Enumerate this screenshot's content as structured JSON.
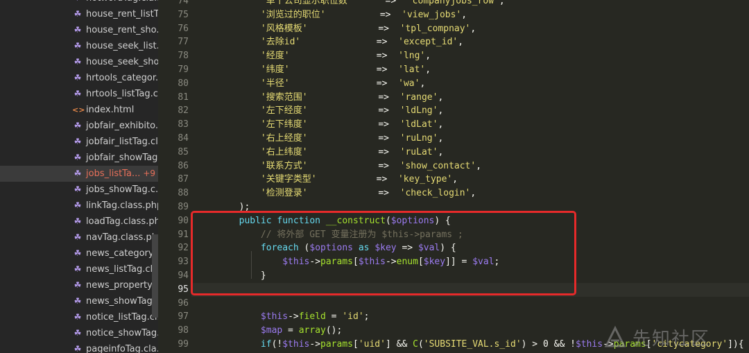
{
  "sidebar": {
    "files": [
      {
        "name": "hotwordTag.cla...",
        "type": "php"
      },
      {
        "name": "house_rent_listT...",
        "type": "php"
      },
      {
        "name": "house_rent_sho...",
        "type": "php"
      },
      {
        "name": "house_seek_list...",
        "type": "php"
      },
      {
        "name": "house_seek_sho...",
        "type": "php"
      },
      {
        "name": "hrtools_categor...",
        "type": "php"
      },
      {
        "name": "hrtools_listTag.c...",
        "type": "php"
      },
      {
        "name": "index.html",
        "type": "html"
      },
      {
        "name": "jobfair_exhibito...",
        "type": "php"
      },
      {
        "name": "jobfair_listTag.cl...",
        "type": "php"
      },
      {
        "name": "jobfair_showTag...",
        "type": "php"
      },
      {
        "name": "jobs_listTa...",
        "type": "php",
        "active": true,
        "badge": "+9"
      },
      {
        "name": "jobs_showTag.c...",
        "type": "php"
      },
      {
        "name": "linkTag.class.php",
        "type": "php"
      },
      {
        "name": "loadTag.class.ph...",
        "type": "php"
      },
      {
        "name": "navTag.class.php",
        "type": "php"
      },
      {
        "name": "news_categoryT...",
        "type": "php"
      },
      {
        "name": "news_listTag.cla...",
        "type": "php"
      },
      {
        "name": "news_propertyT...",
        "type": "php"
      },
      {
        "name": "news_showTag....",
        "type": "php"
      },
      {
        "name": "notice_listTag.cl...",
        "type": "php"
      },
      {
        "name": "notice_showTag...",
        "type": "php"
      },
      {
        "name": "pageinfoTag.cla...",
        "type": "php"
      }
    ]
  },
  "editor": {
    "current_line": "95",
    "lines": [
      {
        "n": "74",
        "tokens": [
          [
            "str",
            "            '单个公司显示职位数'"
          ],
          [
            "op",
            "      =>  "
          ],
          [
            "str",
            "'companyjobs_row'"
          ],
          [
            "op",
            ","
          ]
        ]
      },
      {
        "n": "75",
        "tokens": [
          [
            "str",
            "            '浏览过的职位'"
          ],
          [
            "op",
            "          =>  "
          ],
          [
            "str",
            "'view_jobs'"
          ],
          [
            "op",
            ","
          ]
        ]
      },
      {
        "n": "76",
        "tokens": [
          [
            "str",
            "            '风格模板'"
          ],
          [
            "op",
            "             =>  "
          ],
          [
            "str",
            "'tpl_compnay'"
          ],
          [
            "op",
            ","
          ]
        ]
      },
      {
        "n": "77",
        "tokens": [
          [
            "str",
            "            '去除id'"
          ],
          [
            "op",
            "              =>  "
          ],
          [
            "str",
            "'except_id'"
          ],
          [
            "op",
            ","
          ]
        ]
      },
      {
        "n": "78",
        "tokens": [
          [
            "str",
            "            '经度'"
          ],
          [
            "op",
            "                =>  "
          ],
          [
            "str",
            "'lng'"
          ],
          [
            "op",
            ","
          ]
        ]
      },
      {
        "n": "79",
        "tokens": [
          [
            "str",
            "            '纬度'"
          ],
          [
            "op",
            "                =>  "
          ],
          [
            "str",
            "'lat'"
          ],
          [
            "op",
            ","
          ]
        ]
      },
      {
        "n": "80",
        "tokens": [
          [
            "str",
            "            '半径'"
          ],
          [
            "op",
            "                =>  "
          ],
          [
            "str",
            "'wa'"
          ],
          [
            "op",
            ","
          ]
        ]
      },
      {
        "n": "81",
        "tokens": [
          [
            "str",
            "            '搜索范围'"
          ],
          [
            "op",
            "             =>  "
          ],
          [
            "str",
            "'range'"
          ],
          [
            "op",
            ","
          ]
        ]
      },
      {
        "n": "82",
        "tokens": [
          [
            "str",
            "            '左下经度'"
          ],
          [
            "op",
            "             =>  "
          ],
          [
            "str",
            "'ldLng'"
          ],
          [
            "op",
            ","
          ]
        ]
      },
      {
        "n": "83",
        "tokens": [
          [
            "str",
            "            '左下纬度'"
          ],
          [
            "op",
            "             =>  "
          ],
          [
            "str",
            "'ldLat'"
          ],
          [
            "op",
            ","
          ]
        ]
      },
      {
        "n": "84",
        "tokens": [
          [
            "str",
            "            '右上经度'"
          ],
          [
            "op",
            "             =>  "
          ],
          [
            "str",
            "'ruLng'"
          ],
          [
            "op",
            ","
          ]
        ]
      },
      {
        "n": "85",
        "tokens": [
          [
            "str",
            "            '右上纬度'"
          ],
          [
            "op",
            "             =>  "
          ],
          [
            "str",
            "'ruLat'"
          ],
          [
            "op",
            ","
          ]
        ]
      },
      {
        "n": "86",
        "tokens": [
          [
            "str",
            "            '联系方式'"
          ],
          [
            "op",
            "             =>  "
          ],
          [
            "str",
            "'show_contact'"
          ],
          [
            "op",
            ","
          ]
        ]
      },
      {
        "n": "87",
        "tokens": [
          [
            "str",
            "            '关键字类型'"
          ],
          [
            "op",
            "           =>  "
          ],
          [
            "str",
            "'key_type'"
          ],
          [
            "op",
            ","
          ]
        ]
      },
      {
        "n": "88",
        "tokens": [
          [
            "str",
            "            '检测登录'"
          ],
          [
            "op",
            "             =>  "
          ],
          [
            "str",
            "'check_login'"
          ],
          [
            "op",
            ","
          ]
        ]
      },
      {
        "n": "89",
        "tokens": [
          [
            "pl",
            "        );"
          ]
        ]
      },
      {
        "n": "90",
        "tokens": [
          [
            "kw",
            "        public function "
          ],
          [
            "fn",
            "__construct"
          ],
          [
            "pl",
            "("
          ],
          [
            "var",
            "$options"
          ],
          [
            "pl",
            ") {"
          ]
        ]
      },
      {
        "n": "91",
        "tokens": [
          [
            "cmt",
            "            // 将外部 GET 变量注册为 $this->params ;"
          ]
        ]
      },
      {
        "n": "92",
        "tokens": [
          [
            "kw",
            "            foreach "
          ],
          [
            "pl",
            "("
          ],
          [
            "var",
            "$options"
          ],
          [
            "kw",
            " as "
          ],
          [
            "var",
            "$key"
          ],
          [
            "pl",
            " => "
          ],
          [
            "var",
            "$val"
          ],
          [
            "pl",
            ") {"
          ]
        ]
      },
      {
        "n": "93",
        "tokens": [
          [
            "var",
            "                $this"
          ],
          [
            "pl",
            "->"
          ],
          [
            "prop",
            "params"
          ],
          [
            "pl",
            "["
          ],
          [
            "var",
            "$this"
          ],
          [
            "pl",
            "->"
          ],
          [
            "prop",
            "enum"
          ],
          [
            "pl",
            "["
          ],
          [
            "var",
            "$key"
          ],
          [
            "pl",
            "]] = "
          ],
          [
            "var",
            "$val"
          ],
          [
            "pl",
            ";"
          ]
        ]
      },
      {
        "n": "94",
        "tokens": [
          [
            "pl",
            "            }"
          ]
        ]
      },
      {
        "n": "95",
        "tokens": [
          [
            "pl",
            ""
          ]
        ]
      },
      {
        "n": "96",
        "tokens": [
          [
            "pl",
            ""
          ]
        ]
      },
      {
        "n": "97",
        "tokens": [
          [
            "var",
            "            $this"
          ],
          [
            "pl",
            "->"
          ],
          [
            "prop",
            "field"
          ],
          [
            "pl",
            " = "
          ],
          [
            "str",
            "'id'"
          ],
          [
            "pl",
            ";"
          ]
        ]
      },
      {
        "n": "98",
        "tokens": [
          [
            "var",
            "            $map"
          ],
          [
            "pl",
            " = "
          ],
          [
            "fn",
            "array"
          ],
          [
            "pl",
            "();"
          ]
        ]
      },
      {
        "n": "99",
        "tokens": [
          [
            "kw",
            "            if"
          ],
          [
            "pl",
            "(!"
          ],
          [
            "var",
            "$this"
          ],
          [
            "pl",
            "->"
          ],
          [
            "prop",
            "params"
          ],
          [
            "pl",
            "["
          ],
          [
            "str",
            "'uid'"
          ],
          [
            "pl",
            "] && "
          ],
          [
            "fn",
            "C"
          ],
          [
            "pl",
            "("
          ],
          [
            "str",
            "'SUBSITE_VAL.s_id'"
          ],
          [
            "pl",
            ") > 0 && !"
          ],
          [
            "var",
            "$this"
          ],
          [
            "pl",
            "->"
          ],
          [
            "prop",
            "params"
          ],
          [
            "pl",
            "["
          ],
          [
            "str",
            "'citycategory'"
          ],
          [
            "pl",
            "]){"
          ]
        ]
      }
    ]
  },
  "watermark": {
    "text": "先知社区",
    "logo_icon": "xianzhi-logo-icon"
  },
  "colors": {
    "highlight_box": "#e62a2a",
    "active_file": "#e8705a"
  }
}
